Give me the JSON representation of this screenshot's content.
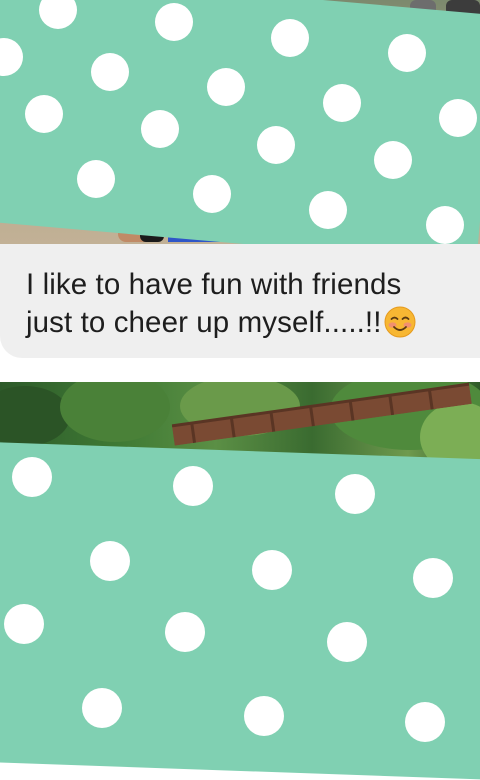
{
  "message": {
    "line1": "I like to have fun with friends",
    "line2": "just to cheer up myself.....!!",
    "emoji": "smiling-face-with-blush"
  },
  "colors": {
    "panel_green": "#80d0b2",
    "dot_white": "#ffffff",
    "bubble_bg": "#efefef",
    "text": "#1e1e1e"
  }
}
